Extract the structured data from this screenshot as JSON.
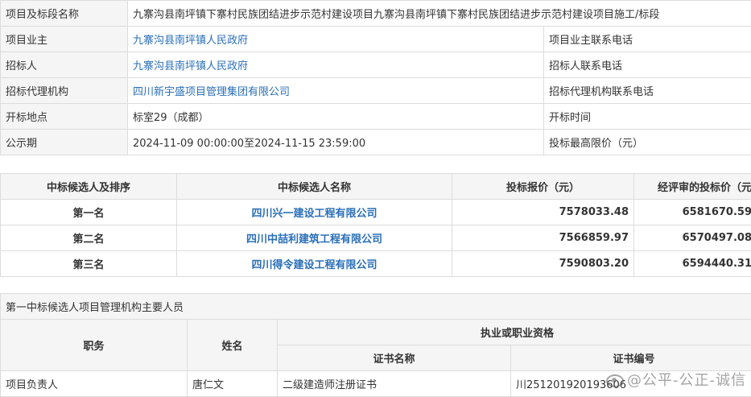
{
  "project_info": {
    "rows": [
      {
        "label": "项目及标段名称",
        "value": "九寨沟县南坪镇下寨村民族团结进步示范村建设项目九寨沟县南坪镇下寨村民族团结进步示范村建设项目施工/标段"
      },
      {
        "label": "项目业主",
        "value": "九寨沟县南坪镇人民政府",
        "right_label": "项目业主联系电话"
      },
      {
        "label": "招标人",
        "value": "九寨沟县南坪镇人民政府",
        "right_label": "招标人联系电话"
      },
      {
        "label": "招标代理机构",
        "value": "四川新宇盛项目管理集团有限公司",
        "right_label": "招标代理机构联系电话"
      },
      {
        "label": "开标地点",
        "value": "标室29（成都）",
        "right_label": "开标时间"
      },
      {
        "label": "公示期",
        "value": "2024-11-09 00:00:00至2024-11-15 23:59:00",
        "right_label": "投标最高限价（元）"
      }
    ]
  },
  "candidates": {
    "headers": [
      "中标候选人及排序",
      "中标候选人名称",
      "投标报价（元）",
      "经评审的投标价（元"
    ],
    "rows": [
      {
        "rank": "第一名",
        "name": "四川兴一建设工程有限公司",
        "bid": "7578033.48",
        "evaluated": "6581670.59"
      },
      {
        "rank": "第二名",
        "name": "四川中喆利建筑工程有限公司",
        "bid": "7566859.97",
        "evaluated": "6570497.08"
      },
      {
        "rank": "第三名",
        "name": "四川得令建设工程有限公司",
        "bid": "7590803.20",
        "evaluated": "6594440.31"
      }
    ]
  },
  "personnel": {
    "caption": "第一中标候选人项目管理机构主要人员",
    "headers": {
      "role": "职务",
      "name": "姓名",
      "qualification": "执业或职业资格",
      "cert_name": "证书名称",
      "cert_no": "证书编号"
    },
    "rows": [
      {
        "role": "项目负责人",
        "name": "唐仁文",
        "cert_name": "二级建造师注册证书",
        "cert_no": "川251201920193606"
      }
    ]
  },
  "watermark": "@公平-公正-诚信"
}
